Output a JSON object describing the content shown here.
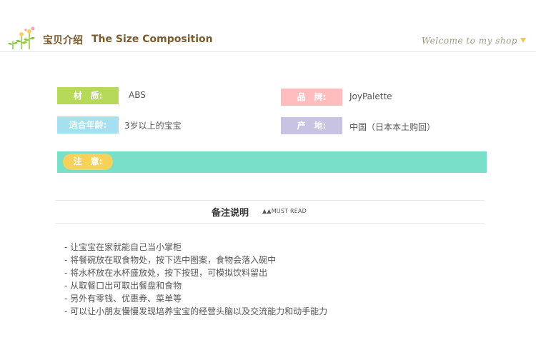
{
  "header": {
    "title_cn": "宝贝介绍",
    "title_en": "The Size Composition",
    "welcome": "Welcome to my shop"
  },
  "specs": {
    "material": {
      "label": "材　质:",
      "value": "ABS"
    },
    "brand": {
      "label": "品　牌:",
      "value": "JoyPalette"
    },
    "age": {
      "label": "适合年龄:",
      "value": "3岁以上的宝宝"
    },
    "origin": {
      "label": "产　地:",
      "value": "中国（日本本土购回）"
    }
  },
  "notice": {
    "label": "注　意:"
  },
  "section": {
    "title": "备注说明",
    "subtitle": "▲▲MUST READ"
  },
  "notes": [
    "- 让宝宝在家就能自己当小掌柜",
    "- 将餐碗放在取食物处，按下选中图案，食物会落入碗中",
    "- 将水杯放在水杯盛放处，按下按钮，可模拟饮料留出",
    "- 从取餐口出可取出餐盘和食物",
    "- 另外有零钱、优惠券、菜单等",
    "- 可以让小朋友慢慢发现培养宝宝的经营头脑以及交流能力和动手能力"
  ],
  "colors": {
    "material_tag": "#b6d95a",
    "brand_tag": "#ffbdbd",
    "age_tag": "#a6dff0",
    "origin_tag": "#c9c3e3",
    "notice_bar": "#7adfc9",
    "notice_pill": "#f7d25a"
  }
}
